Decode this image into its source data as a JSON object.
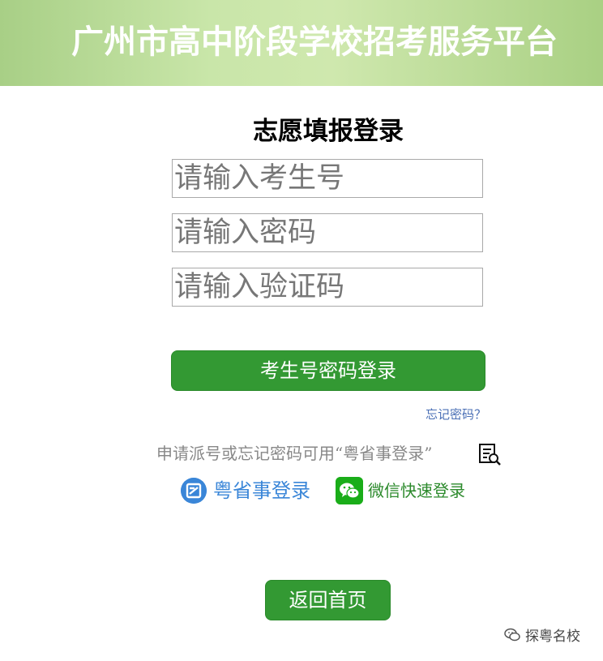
{
  "header": {
    "title": "广州市高中阶段学校招考服务平台"
  },
  "login": {
    "title": "志愿填报登录",
    "exam_id_placeholder": "请输入考生号",
    "password_placeholder": "请输入密码",
    "captcha_placeholder": "请输入验证码",
    "login_button": "考生号密码登录",
    "forgot_password": "忘记密码？",
    "hint": "申请派号或忘记密码可用“粤省事登录”",
    "hint_icon": "document-search-icon",
    "yss_login": "粤省事登录",
    "wechat_login": "微信快速登录",
    "home_button": "返回首页"
  },
  "watermark": {
    "text": "探粤名校"
  },
  "colors": {
    "primary_green": "#339933",
    "header_green": "#c9e6a9",
    "yss_blue": "#3a86d8",
    "wechat_green": "#1aad19",
    "link_blue": "#4a6fb5"
  }
}
